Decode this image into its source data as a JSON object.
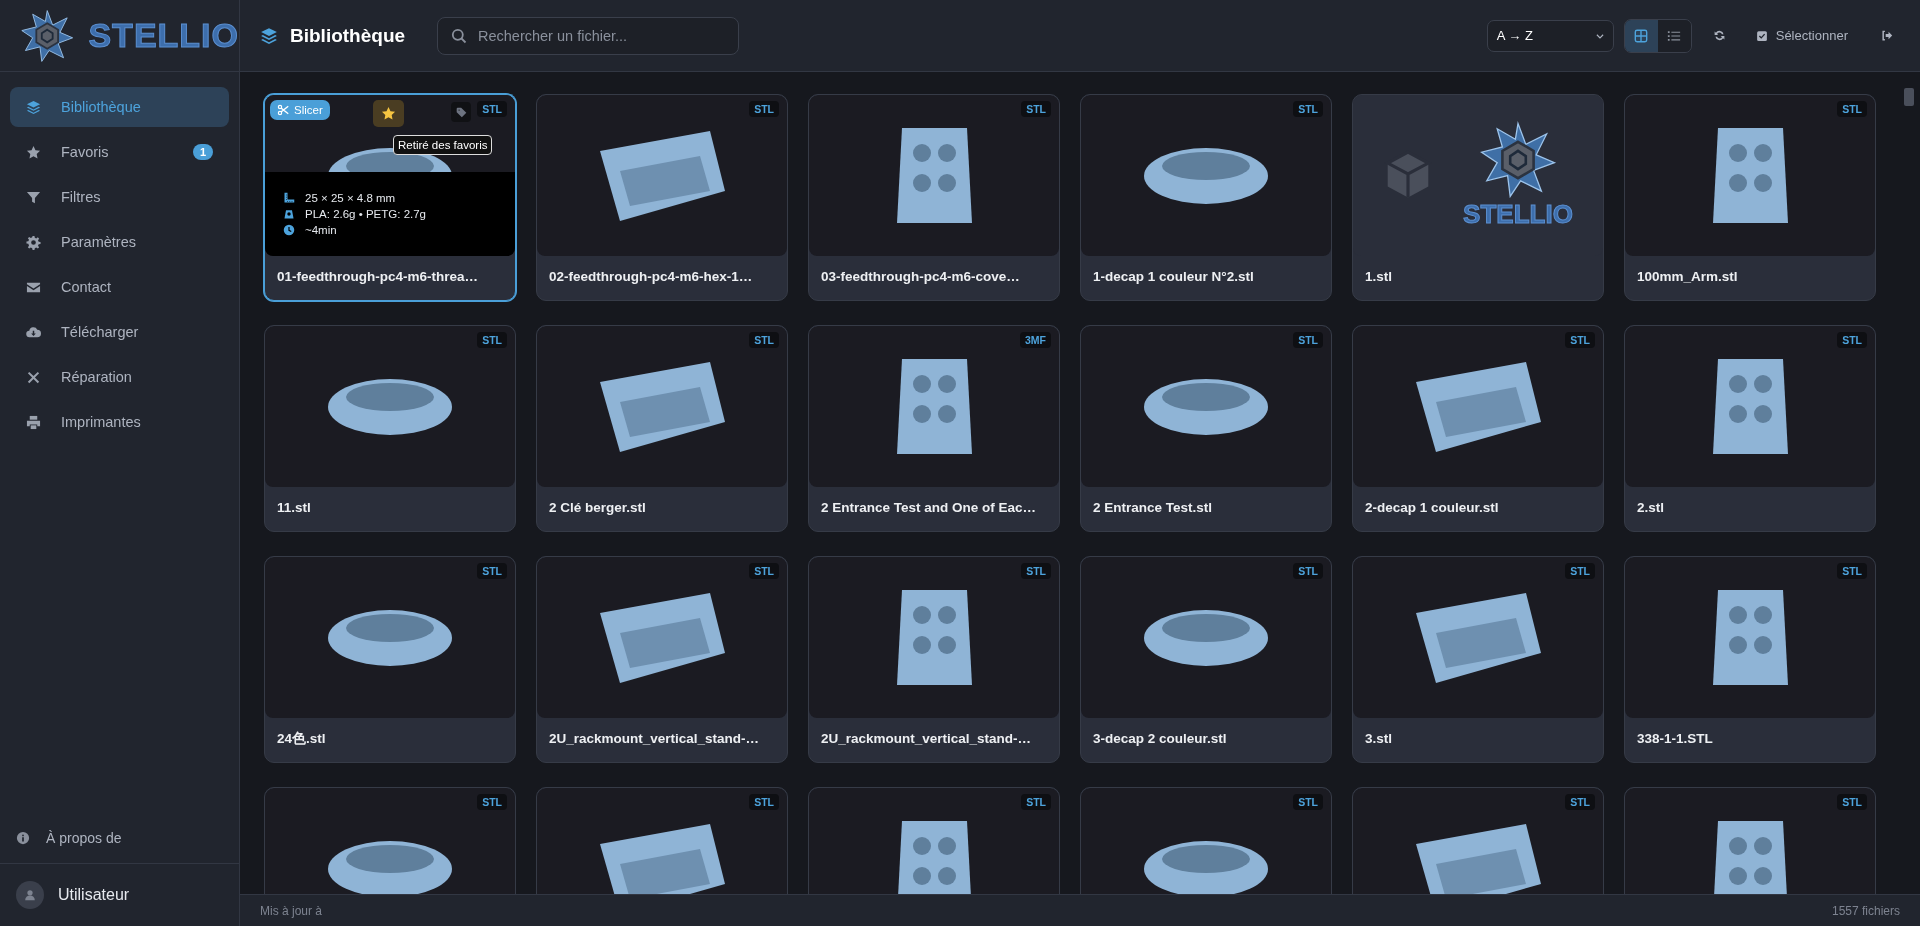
{
  "brand": {
    "name": "STELLIO"
  },
  "sidebar": {
    "items": [
      {
        "label": "Bibliothèque",
        "selected": true
      },
      {
        "label": "Favoris",
        "selected": false,
        "badge": "1"
      },
      {
        "label": "Filtres",
        "selected": false
      },
      {
        "label": "Paramètres",
        "selected": false
      },
      {
        "label": "Contact",
        "selected": false
      },
      {
        "label": "Télécharger",
        "selected": false
      },
      {
        "label": "Réparation",
        "selected": false
      },
      {
        "label": "Imprimantes",
        "selected": false
      }
    ],
    "about": "À propos de",
    "user": "Utilisateur"
  },
  "header": {
    "title": "Bibliothèque",
    "search": {
      "placeholder": "Rechercher un fichier..."
    },
    "sort": "A → Z",
    "views": [
      {
        "kind": "grid",
        "selected": true
      },
      {
        "kind": "list",
        "selected": false
      }
    ],
    "select_button": "Sélectionner"
  },
  "cards": [
    {
      "kind": "model",
      "name": "01-feedthrough-pc4-m6-threa…",
      "format": "STL",
      "selected": true,
      "favorite": true,
      "slicer": "Slicer",
      "tooltip": "Retiré des favoris",
      "details": [
        "25 × 25 × 4.8 mm",
        "PLA: 2.6g • PETG: 2.7g",
        "~4min"
      ]
    },
    {
      "kind": "model",
      "name": "02-feedthrough-pc4-m6-hex-1…",
      "format": "STL",
      "selected": false
    },
    {
      "kind": "model",
      "name": "03-feedthrough-pc4-m6-cove…",
      "format": "STL",
      "selected": false
    },
    {
      "kind": "model",
      "name": "1-decap 1 couleur N°2.stl",
      "format": "STL",
      "selected": false
    },
    {
      "kind": "placeholder",
      "name": "1.stl",
      "logo_text": "STELLIO",
      "selected": false
    },
    {
      "kind": "model",
      "name": "100mm_Arm.stl",
      "format": "STL",
      "selected": false
    },
    {
      "kind": "model",
      "name": "11.stl",
      "format": "STL",
      "selected": false
    },
    {
      "kind": "model",
      "name": "2 Clé berger.stl",
      "format": "STL",
      "selected": false
    },
    {
      "kind": "model",
      "name": "2 Entrance Test and One of Eac…",
      "format": "3MF",
      "selected": false
    },
    {
      "kind": "model",
      "name": "2 Entrance Test.stl",
      "format": "STL",
      "selected": false
    },
    {
      "kind": "model",
      "name": "2-decap 1 couleur.stl",
      "format": "STL",
      "selected": false
    },
    {
      "kind": "model",
      "name": "2.stl",
      "format": "STL",
      "selected": false
    },
    {
      "kind": "model",
      "name": "24色.stl",
      "format": "STL",
      "selected": false
    },
    {
      "kind": "model",
      "name": "2U_rackmount_vertical_stand-…",
      "format": "STL",
      "selected": false
    },
    {
      "kind": "model",
      "name": "2U_rackmount_vertical_stand-…",
      "format": "STL",
      "selected": false
    },
    {
      "kind": "model",
      "name": "3-decap 2 couleur.stl",
      "format": "STL",
      "selected": false
    },
    {
      "kind": "model",
      "name": "3.stl",
      "format": "STL",
      "selected": false
    },
    {
      "kind": "model",
      "name": "338-1-1.STL",
      "format": "STL",
      "selected": false
    },
    {
      "kind": "model",
      "format": "STL",
      "selected": false
    },
    {
      "kind": "model",
      "format": "STL",
      "selected": false
    },
    {
      "kind": "model",
      "format": "STL",
      "selected": false
    },
    {
      "kind": "model",
      "format": "STL",
      "selected": false
    },
    {
      "kind": "model",
      "format": "STL",
      "selected": false
    },
    {
      "kind": "model",
      "format": "STL",
      "selected": false
    }
  ],
  "status_bar": {
    "updated": "Mis à jour à",
    "count": "1557 fichiers"
  }
}
